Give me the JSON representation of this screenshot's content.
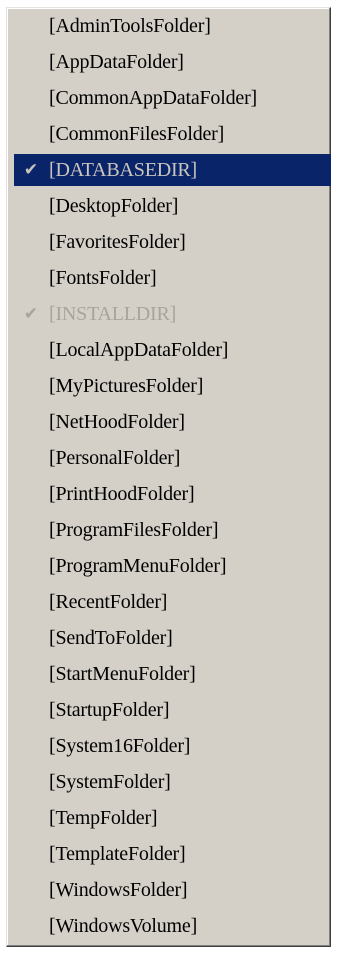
{
  "menu": {
    "colors": {
      "background": "#d4d0c8",
      "selected_background": "#0a246a",
      "selected_text": "#c9c5bd",
      "disabled_text": "#a8a49c",
      "text": "#000000"
    },
    "items": [
      {
        "label": "[AdminToolsFolder]",
        "checked": false,
        "selected": false,
        "disabled": false
      },
      {
        "label": "[AppDataFolder]",
        "checked": false,
        "selected": false,
        "disabled": false
      },
      {
        "label": "[CommonAppDataFolder]",
        "checked": false,
        "selected": false,
        "disabled": false
      },
      {
        "label": "[CommonFilesFolder]",
        "checked": false,
        "selected": false,
        "disabled": false
      },
      {
        "label": "[DATABASEDIR]",
        "checked": true,
        "selected": true,
        "disabled": false
      },
      {
        "label": "[DesktopFolder]",
        "checked": false,
        "selected": false,
        "disabled": false
      },
      {
        "label": "[FavoritesFolder]",
        "checked": false,
        "selected": false,
        "disabled": false
      },
      {
        "label": "[FontsFolder]",
        "checked": false,
        "selected": false,
        "disabled": false
      },
      {
        "label": "[INSTALLDIR]",
        "checked": true,
        "selected": false,
        "disabled": true
      },
      {
        "label": "[LocalAppDataFolder]",
        "checked": false,
        "selected": false,
        "disabled": false
      },
      {
        "label": "[MyPicturesFolder]",
        "checked": false,
        "selected": false,
        "disabled": false
      },
      {
        "label": "[NetHoodFolder]",
        "checked": false,
        "selected": false,
        "disabled": false
      },
      {
        "label": "[PersonalFolder]",
        "checked": false,
        "selected": false,
        "disabled": false
      },
      {
        "label": "[PrintHoodFolder]",
        "checked": false,
        "selected": false,
        "disabled": false
      },
      {
        "label": "[ProgramFilesFolder]",
        "checked": false,
        "selected": false,
        "disabled": false
      },
      {
        "label": "[ProgramMenuFolder]",
        "checked": false,
        "selected": false,
        "disabled": false
      },
      {
        "label": "[RecentFolder]",
        "checked": false,
        "selected": false,
        "disabled": false
      },
      {
        "label": "[SendToFolder]",
        "checked": false,
        "selected": false,
        "disabled": false
      },
      {
        "label": "[StartMenuFolder]",
        "checked": false,
        "selected": false,
        "disabled": false
      },
      {
        "label": "[StartupFolder]",
        "checked": false,
        "selected": false,
        "disabled": false
      },
      {
        "label": "[System16Folder]",
        "checked": false,
        "selected": false,
        "disabled": false
      },
      {
        "label": "[SystemFolder]",
        "checked": false,
        "selected": false,
        "disabled": false
      },
      {
        "label": "[TempFolder]",
        "checked": false,
        "selected": false,
        "disabled": false
      },
      {
        "label": "[TemplateFolder]",
        "checked": false,
        "selected": false,
        "disabled": false
      },
      {
        "label": "[WindowsFolder]",
        "checked": false,
        "selected": false,
        "disabled": false
      },
      {
        "label": "[WindowsVolume]",
        "checked": false,
        "selected": false,
        "disabled": false
      }
    ]
  }
}
